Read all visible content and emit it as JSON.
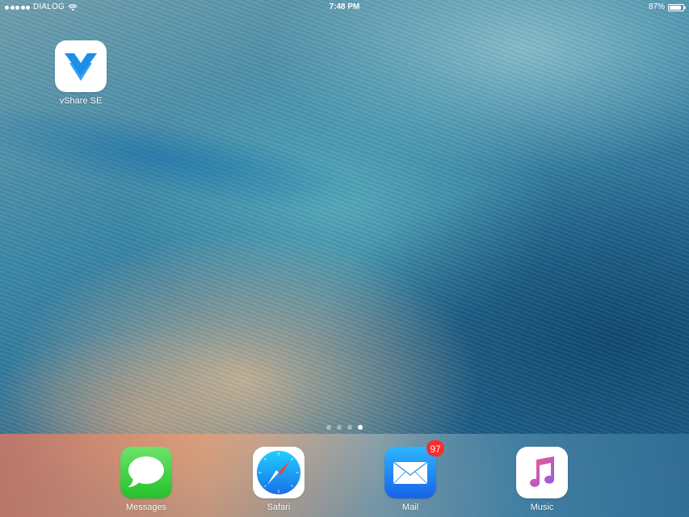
{
  "status_bar": {
    "carrier": "DIALOG",
    "time": "7:48 PM",
    "battery_percent_label": "87%",
    "battery_level": 0.87,
    "signal_bars": 5,
    "wifi": "wifi-icon"
  },
  "home_apps": [
    {
      "label": "vShare SE",
      "icon": "vshare-icon"
    }
  ],
  "page_indicator": {
    "pages": 4,
    "current": 4
  },
  "dock": {
    "apps": [
      {
        "label": "Messages",
        "icon": "messages-icon"
      },
      {
        "label": "Safari",
        "icon": "safari-icon"
      },
      {
        "label": "Mail",
        "icon": "mail-icon",
        "badge": "97"
      },
      {
        "label": "Music",
        "icon": "music-icon"
      }
    ]
  },
  "colors": {
    "badge": "#ff2b2b",
    "vshare_blue": "#1a8fe8"
  }
}
